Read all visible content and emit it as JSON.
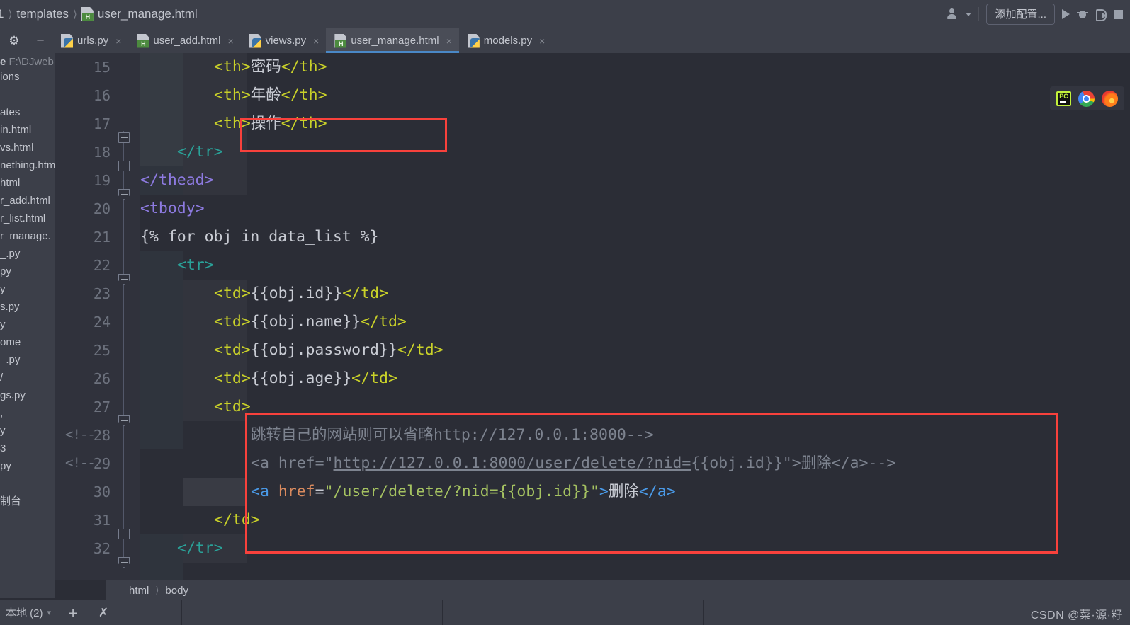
{
  "window": {
    "breadcrumb": {
      "project_fragment": "1",
      "items": [
        "templates",
        "user_manage.html"
      ],
      "file_icon": "html-file-icon"
    },
    "toolbar_right": {
      "account_icon": "person-icon",
      "account_caret": "chevron-down-icon",
      "add_config_label": "添加配置...",
      "run_icon": "run-triangle-icon",
      "debug_icon": "bug-icon",
      "coverage_icon": "coverage-icon",
      "stop_icon": "stop-square-icon"
    }
  },
  "tabstrip": {
    "gear_icon": "gear-icon",
    "minimize_icon": "minus-icon",
    "close_glyph": "×",
    "tabs": [
      {
        "label": "urls.py",
        "icon": "python-file-icon",
        "active": false
      },
      {
        "label": "user_add.html",
        "icon": "html-file-icon",
        "active": false
      },
      {
        "label": "views.py",
        "icon": "python-file-icon",
        "active": false
      },
      {
        "label": "user_manage.html",
        "icon": "html-file-icon",
        "active": true
      },
      {
        "label": "models.py",
        "icon": "python-file-icon",
        "active": false
      }
    ]
  },
  "project_pane": {
    "header_bold": "e",
    "header_path": "F:\\DJweb",
    "rows": [
      "ions",
      "",
      "ates",
      "in.html",
      "vs.html",
      "nething.htm",
      "html",
      "r_add.html",
      "r_list.html",
      "r_manage.",
      "_.py",
      "py",
      "y",
      "s.py",
      "y",
      "ome",
      "_.py",
      "/",
      "gs.py",
      ",",
      "y",
      "3",
      "py",
      "",
      "制台"
    ]
  },
  "editor": {
    "first_visible_line": 14,
    "lines": [
      {
        "n": 15,
        "text": "        <th>密码</th>"
      },
      {
        "n": 16,
        "text": "        <th>年龄</th>"
      },
      {
        "n": 17,
        "text": "        <th>操作</th>"
      },
      {
        "n": 18,
        "text": "    </tr>"
      },
      {
        "n": 19,
        "text": "</thead>"
      },
      {
        "n": 20,
        "text": "<tbody>"
      },
      {
        "n": 21,
        "text": "{% for obj in data_list %}"
      },
      {
        "n": 22,
        "text": "    <tr>"
      },
      {
        "n": 23,
        "text": "        <td>{{obj.id}}</td>"
      },
      {
        "n": 24,
        "text": "        <td>{{obj.name}}</td>"
      },
      {
        "n": 25,
        "text": "        <td>{{obj.password}}</td>"
      },
      {
        "n": 26,
        "text": "        <td>{{obj.age}}</td>"
      },
      {
        "n": 27,
        "text": "        <td>"
      },
      {
        "n": 28,
        "text": "            跳转自己的网站则可以省略http://127.0.0.1:8000-->"
      },
      {
        "n": 29,
        "text": "            <a href=\"http://127.0.0.1:8000/user/delete/?nid={{obj.id}}\">删除</a>-->"
      },
      {
        "n": 30,
        "text": "            <a href=\"/user/delete/?nid={{obj.id}}\">删除</a>"
      },
      {
        "n": 31,
        "text": "        </td>"
      },
      {
        "n": 32,
        "text": "    </tr>"
      }
    ],
    "gutter_comment_marks": [
      {
        "n": 28,
        "text": "<!--"
      },
      {
        "n": 29,
        "text": "<!--"
      }
    ],
    "breadcrumb": [
      "html",
      "body"
    ],
    "annotation_boxes": [
      {
        "name": "th-operation-highlight",
        "lines": [
          17
        ]
      },
      {
        "name": "td-delete-block-highlight",
        "lines": [
          27,
          28,
          29,
          30,
          31
        ]
      }
    ]
  },
  "tray": {
    "icons": [
      "pycharm-icon",
      "chrome-icon",
      "firefox-icon"
    ]
  },
  "statusbar": {
    "local_label": "本地 (2)",
    "chevron_icon": "chevron-down-icon",
    "add_icon": "plus-icon",
    "expand_icon": "chevron-down-icon"
  },
  "watermark": "CSDN @菜·源·籽",
  "colors": {
    "bg_editor": "#2b2d36",
    "bg_chrome": "#3c3f49",
    "gutter": "#30323c",
    "tag": "#c9d129",
    "purple": "#8d7ae0",
    "teal": "#2aa198",
    "text": "#c9ccd4",
    "comment": "#7d838f",
    "link_blue": "#4a9ae8",
    "attr_orange": "#d98a5e",
    "value_green": "#a5c261",
    "annotation_red": "#f8413c",
    "active_tab_underline": "#4a88c7"
  }
}
